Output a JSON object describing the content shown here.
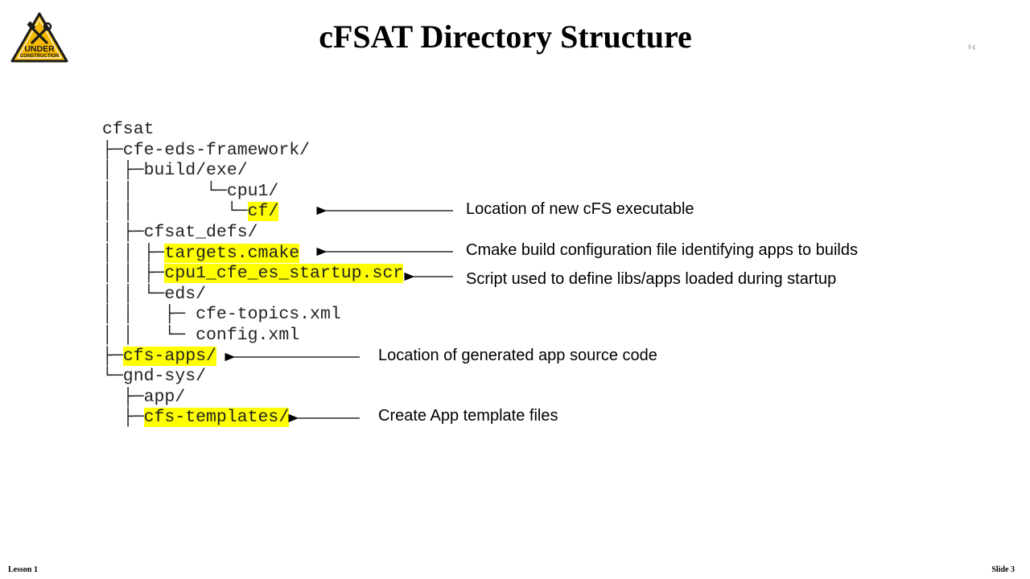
{
  "slide": {
    "title": "cFSAT Directory Structure",
    "logo": {
      "icon": "under-construction-sign-icon",
      "line1": "UNDER",
      "line2": "CONSTRUCTION",
      "color": "#f5b800"
    },
    "corner_mark": "‡¢"
  },
  "tree": [
    {
      "text": "cfsat"
    },
    {
      "text": "├─cfe-eds-framework/"
    },
    {
      "text": "│ ├─build/exe/"
    },
    {
      "text": "│ │       └─cpu1/"
    },
    {
      "prefix": "│ │         └─",
      "hl": "cf/"
    },
    {
      "text": "│ ├─cfsat_defs/"
    },
    {
      "prefix": "│ │ ├─",
      "hl": "targets.cmake"
    },
    {
      "prefix": "│ │ ├─",
      "hl": "cpu1_cfe_es_startup.scr"
    },
    {
      "text": "│ │ └─eds/"
    },
    {
      "text": "│ │   ├─ cfe-topics.xml"
    },
    {
      "text": "│ │   └─ config.xml"
    },
    {
      "prefix": "├─",
      "hl": "cfs-apps/"
    },
    {
      "text": "└─gnd-sys/"
    },
    {
      "text": "  ├─app/"
    },
    {
      "prefix": "  ├─",
      "hl": "cfs-templates/"
    }
  ],
  "annotations": [
    "Location of new cFS executable",
    "Cmake build configuration file identifying apps to builds",
    "Script used to define libs/apps loaded during startup",
    "Location of generated app source code",
    "Create App  template files"
  ],
  "highlight_color": "#ffff00",
  "footer": {
    "left": "Lesson 1",
    "right": "Slide 3"
  }
}
